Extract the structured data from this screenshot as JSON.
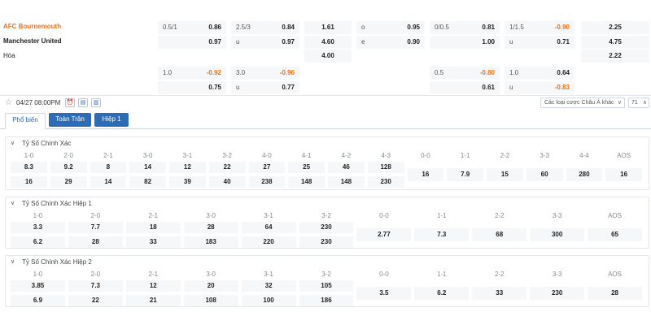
{
  "match": {
    "home": "AFC Bournemouth",
    "away": "Manchester United",
    "draw": "Hòa"
  },
  "odds_row1": [
    [
      "0.5/1",
      "0.86"
    ],
    [
      "2.5/3",
      "0.84"
    ],
    [
      "",
      "1.61"
    ],
    [
      "o",
      "0.95"
    ],
    [
      "0/0.5",
      "0.81"
    ],
    [
      "1/1.5",
      "-0.90"
    ],
    [
      "",
      "2.25"
    ]
  ],
  "odds_row2": [
    [
      "",
      "0.97"
    ],
    [
      "u",
      "0.97"
    ],
    [
      "",
      "4.60"
    ],
    [
      "e",
      "0.90"
    ],
    [
      "",
      "1.00"
    ],
    [
      "u",
      "0.71"
    ],
    [
      "",
      "4.75"
    ]
  ],
  "odds_row3": [
    [
      "",
      "4.00"
    ],
    [
      "",
      "2.22"
    ]
  ],
  "odds_row4": [
    [
      "1.0",
      "-0.92"
    ],
    [
      "3.0",
      "-0.96"
    ],
    [
      "0.5",
      "-0.80"
    ],
    [
      "1.0",
      "0.64"
    ]
  ],
  "odds_row5": [
    [
      "",
      "0.75"
    ],
    [
      "u",
      "0.77"
    ],
    [
      "",
      "0.61"
    ],
    [
      "u",
      "-0.83"
    ]
  ],
  "toolbar": {
    "kickoff": "04/27 08:00PM",
    "select": "Các loại cược Châu Á khác",
    "page": "71"
  },
  "tabs": [
    "Phổ biến",
    "Toàn Trận",
    "Hiệp 1"
  ],
  "sections": [
    {
      "title": "Tỷ Số Chính Xác",
      "paired": [
        {
          "label": "1-0",
          "top": "8.3",
          "bottom": "16"
        },
        {
          "label": "2-0",
          "top": "9.2",
          "bottom": "29"
        },
        {
          "label": "2-1",
          "top": "8",
          "bottom": "14"
        },
        {
          "label": "3-0",
          "top": "14",
          "bottom": "82"
        },
        {
          "label": "3-1",
          "top": "12",
          "bottom": "39"
        },
        {
          "label": "3-2",
          "top": "22",
          "bottom": "40"
        },
        {
          "label": "4-0",
          "top": "27",
          "bottom": "238"
        },
        {
          "label": "4-1",
          "top": "25",
          "bottom": "148"
        },
        {
          "label": "4-2",
          "top": "46",
          "bottom": "148"
        },
        {
          "label": "4-3",
          "top": "128",
          "bottom": "230"
        }
      ],
      "single": [
        {
          "label": "0-0",
          "value": "16"
        },
        {
          "label": "1-1",
          "value": "7.9"
        },
        {
          "label": "2-2",
          "value": "15"
        },
        {
          "label": "3-3",
          "value": "60"
        },
        {
          "label": "4-4",
          "value": "280"
        },
        {
          "label": "AOS",
          "value": "16"
        }
      ]
    },
    {
      "title": "Tỷ Số Chính Xác Hiệp 1",
      "paired": [
        {
          "label": "1-0",
          "top": "3.3",
          "bottom": "6.2"
        },
        {
          "label": "2-0",
          "top": "7.7",
          "bottom": "28"
        },
        {
          "label": "2-1",
          "top": "18",
          "bottom": "33"
        },
        {
          "label": "3-0",
          "top": "28",
          "bottom": "183"
        },
        {
          "label": "3-1",
          "top": "64",
          "bottom": "220"
        },
        {
          "label": "3-2",
          "top": "230",
          "bottom": "230"
        }
      ],
      "single": [
        {
          "label": "0-0",
          "value": "2.77"
        },
        {
          "label": "1-1",
          "value": "7.3"
        },
        {
          "label": "2-2",
          "value": "68"
        },
        {
          "label": "3-3",
          "value": "300"
        },
        {
          "label": "AOS",
          "value": "65"
        }
      ]
    },
    {
      "title": "Tỷ Số Chính Xác Hiệp 2",
      "paired": [
        {
          "label": "1-0",
          "top": "3.85",
          "bottom": "6.9"
        },
        {
          "label": "2-0",
          "top": "7.3",
          "bottom": "22"
        },
        {
          "label": "2-1",
          "top": "12",
          "bottom": "21"
        },
        {
          "label": "3-0",
          "top": "20",
          "bottom": "108"
        },
        {
          "label": "3-1",
          "top": "32",
          "bottom": "100"
        },
        {
          "label": "3-2",
          "top": "105",
          "bottom": "186"
        }
      ],
      "single": [
        {
          "label": "0-0",
          "value": "3.5"
        },
        {
          "label": "1-1",
          "value": "6.2"
        },
        {
          "label": "2-2",
          "value": "33"
        },
        {
          "label": "3-3",
          "value": "230"
        },
        {
          "label": "AOS",
          "value": "28"
        }
      ]
    }
  ],
  "colors": {
    "accent": "#2c6bb5",
    "home": "#e8731a",
    "negative": "#e8731a"
  }
}
